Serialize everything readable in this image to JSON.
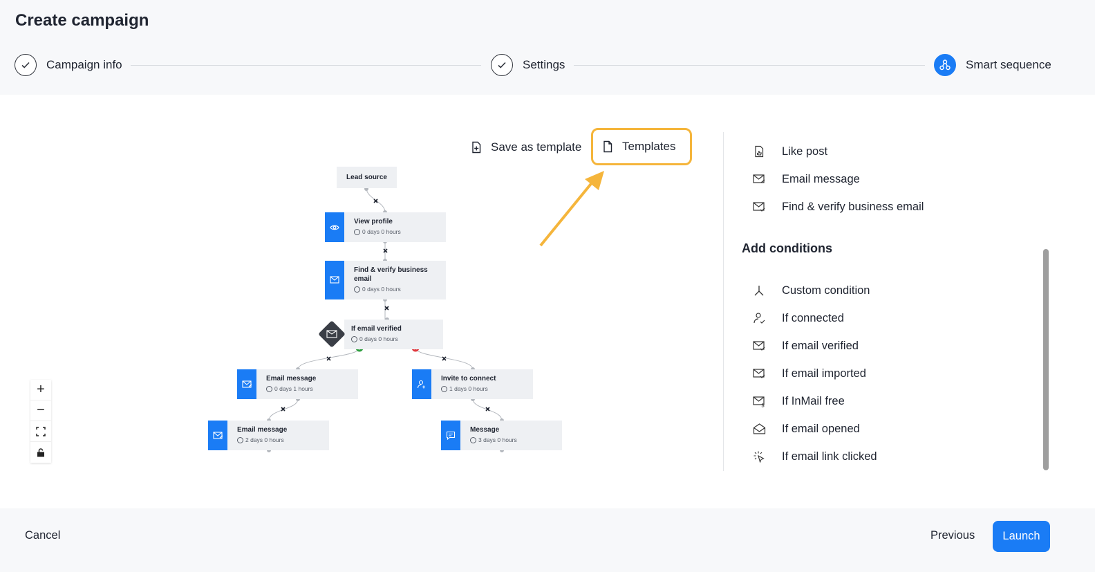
{
  "header": {
    "title": "Create campaign",
    "steps": [
      {
        "label": "Campaign info",
        "state": "done"
      },
      {
        "label": "Settings",
        "state": "done"
      },
      {
        "label": "Smart sequence",
        "state": "active"
      }
    ]
  },
  "toolbar": {
    "save_template_label": "Save as template",
    "templates_label": "Templates"
  },
  "flow": {
    "lead_source": "Lead source",
    "nodes": [
      {
        "title": "View profile",
        "delay": "0 days 0 hours",
        "icon": "eye-icon"
      },
      {
        "title": "Find & verify business",
        "title2": "email",
        "delay": "0 days 0 hours",
        "icon": "mail-check-icon"
      },
      {
        "title": "If email verified",
        "delay": "0 days 0 hours",
        "icon": "mail-icon"
      },
      {
        "title": "Email message",
        "delay": "0 days 1 hours",
        "icon": "mail-send-icon"
      },
      {
        "title": "Invite to connect",
        "delay": "1 days 0 hours",
        "icon": "user-add-icon"
      },
      {
        "title": "Email message",
        "delay": "2 days 0 hours",
        "icon": "mail-send-icon"
      },
      {
        "title": "Message",
        "delay": "3 days 0 hours",
        "icon": "chat-icon"
      }
    ]
  },
  "sidebar": {
    "actions": [
      {
        "label": "Like post",
        "icon": "like-post-icon"
      },
      {
        "label": "Email message",
        "icon": "mail-send-icon"
      },
      {
        "label": "Find & verify business email",
        "icon": "mail-check-icon"
      }
    ],
    "conditions_heading": "Add conditions",
    "conditions": [
      {
        "label": "Custom condition",
        "icon": "branch-icon"
      },
      {
        "label": "If connected",
        "icon": "user-check-icon"
      },
      {
        "label": "If email verified",
        "icon": "mail-check-icon"
      },
      {
        "label": "If email imported",
        "icon": "mail-check-icon"
      },
      {
        "label": "If InMail free",
        "icon": "mail-dollar-icon"
      },
      {
        "label": "If email opened",
        "icon": "mail-open-icon"
      },
      {
        "label": "If email link clicked",
        "icon": "click-icon"
      }
    ]
  },
  "footer": {
    "cancel_label": "Cancel",
    "previous_label": "Previous",
    "launch_label": "Launch"
  },
  "colors": {
    "accent": "#1a7cf5",
    "highlight": "#f5b53b",
    "success": "#2e9e3f",
    "danger": "#e0393e"
  }
}
